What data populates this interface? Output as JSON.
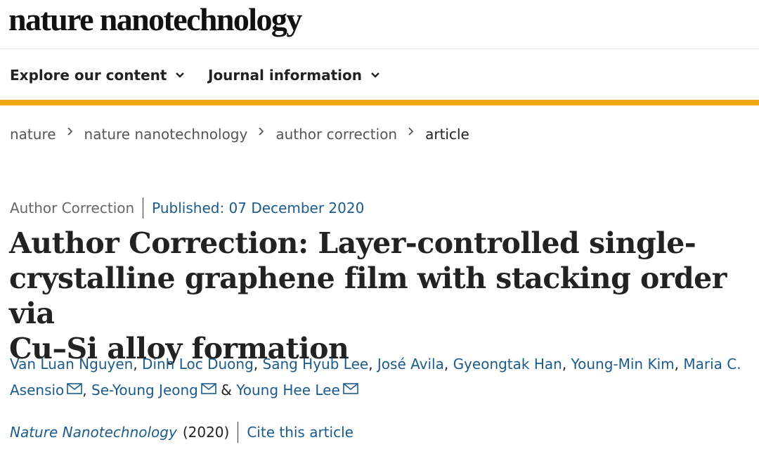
{
  "header": {
    "logo_text": "nature nanotechnology"
  },
  "nav": {
    "explore_label": "Explore our content",
    "journal_label": "Journal information",
    "accent_color": "#f4a912"
  },
  "breadcrumb": [
    "nature",
    "nature nanotechnology",
    "author correction",
    "article"
  ],
  "article": {
    "type": "Author Correction",
    "published": "Published: 07 December 2020",
    "title_line1": "Author Correction: Layer-controlled single-",
    "title_line2": "crystalline graphene film with stacking order via",
    "title_line3": "Cu–Si alloy formation",
    "authors": [
      "Van Luan Nguyen",
      "Dinh Loc Duong",
      "Sang Hyub Lee",
      "José Avila",
      "Gyeongtak Han",
      "Young-Min Kim",
      "Maria C. Asensio",
      "Se-Young Jeong",
      "Young Hee Lee"
    ],
    "separator": ", ",
    "and_text": " & ",
    "journal": "Nature Nanotechnology",
    "year": "(2020)",
    "cite_label": "Cite this article"
  }
}
